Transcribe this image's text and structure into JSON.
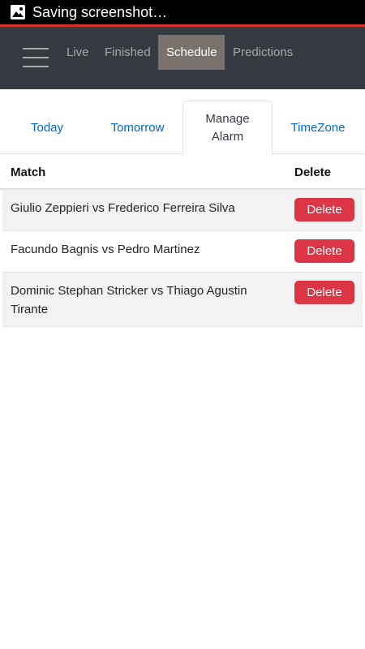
{
  "status_bar": {
    "text": "Saving screenshot…",
    "icon": "image-icon"
  },
  "nav": {
    "menu_icon": "hamburger-menu-icon",
    "links": [
      "Live",
      "Finished",
      "Schedule",
      "Predictions"
    ],
    "active": "Schedule"
  },
  "tabs": {
    "today": "Today",
    "tomorrow": "Tomorrow",
    "manage_line1": "Manage",
    "manage_line2": "Alarm",
    "timezone": "TimeZone",
    "active": "Manage Alarm"
  },
  "table": {
    "col_match": "Match",
    "col_delete": "Delete",
    "rows": [
      {
        "match": "Giulio Zeppieri vs Frederico Ferreira Silva",
        "action": "Delete"
      },
      {
        "match": "Facundo Bagnis vs Pedro Martinez",
        "action": "Delete"
      },
      {
        "match": "Dominic Stephan Stricker vs Thiago Agustin Tirante",
        "action": "Delete"
      }
    ]
  },
  "colors": {
    "navbar": "#343a40",
    "active_nav": "#78716c",
    "link": "#0066cc",
    "danger": "#dc3545",
    "status_line": "#d32f2f"
  }
}
